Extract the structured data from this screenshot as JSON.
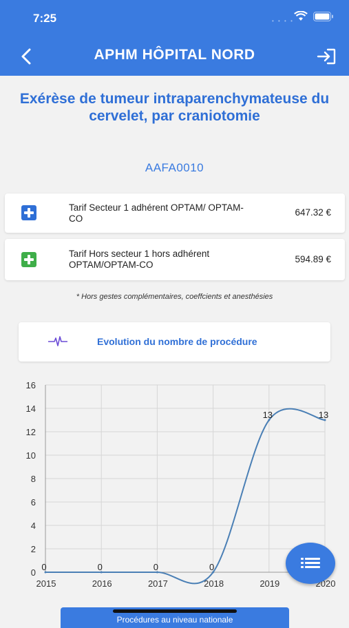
{
  "status": {
    "time": "7:25"
  },
  "header": {
    "title": "APHM HÔPITAL NORD"
  },
  "procedure": {
    "title": "Exérèse de tumeur intraparenchymateuse du cervelet, par craniotomie",
    "code": "AAFA0010"
  },
  "tarifs": [
    {
      "label": "Tarif Secteur 1 adhérent OPTAM/ OPTAM-CO",
      "price": "647.32 €",
      "color": "#2f6fd6",
      "icon": "plus-square-icon"
    },
    {
      "label": "Tarif Hors secteur 1 hors adhérent OPTAM/OPTAM-CO",
      "price": "594.89 €",
      "color": "#3fae49",
      "icon": "plus-square-icon"
    }
  ],
  "note": "* Hors gestes complémentaires, coeffcients et anesthésies",
  "evolution": {
    "label": "Evolution du nombre de procédure",
    "icon": "heartbeat-icon"
  },
  "chart_data": {
    "type": "line",
    "x": [
      "2015",
      "2016",
      "2017",
      "2018",
      "2019",
      "2020"
    ],
    "series": [
      {
        "values": [
          0,
          0,
          0,
          0,
          13,
          13
        ]
      }
    ],
    "data_labels": [
      "0",
      "0",
      "0",
      "0",
      "13",
      "13"
    ],
    "ylim": [
      0,
      16
    ],
    "yticks": [
      0,
      2,
      4,
      6,
      8,
      10,
      12,
      14,
      16
    ],
    "grid": true,
    "color": "#4a7fb5"
  },
  "bottom_button": {
    "label": "Procédures au niveau nationale"
  },
  "fab": {
    "icon": "list-icon"
  },
  "colors": {
    "primary": "#3a7be0",
    "title": "#2f6fd6",
    "green": "#3fae49"
  }
}
